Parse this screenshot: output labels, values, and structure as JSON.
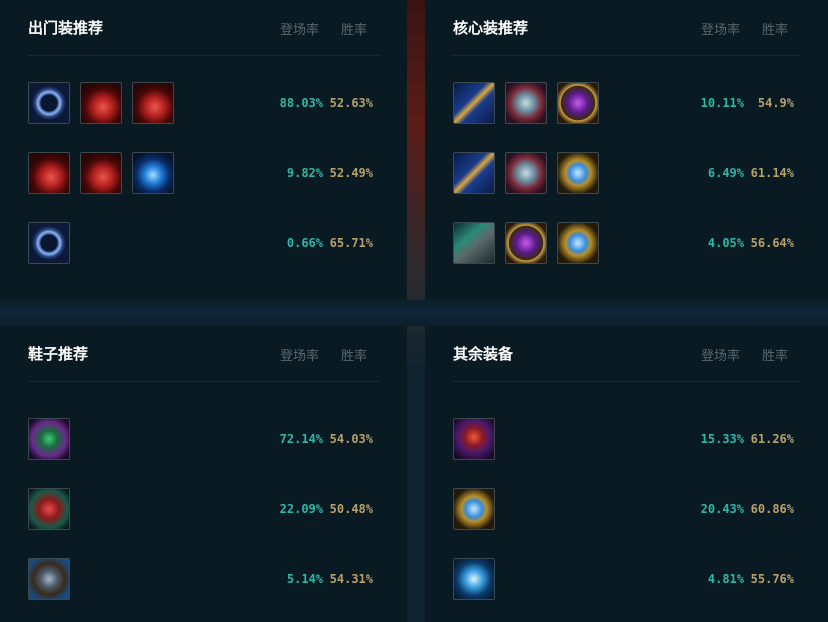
{
  "headers": {
    "pick_rate": "登场率",
    "win_rate": "胜率"
  },
  "panels": [
    {
      "title": "出门装推荐",
      "rows": [
        {
          "items": [
            "ring-icon",
            "health-potion-icon",
            "health-potion-icon"
          ],
          "pick": "88.03%",
          "win": "52.63%"
        },
        {
          "items": [
            "health-potion-icon",
            "health-potion-icon",
            "mana-drop-icon"
          ],
          "pick": "9.82%",
          "win": "52.49%"
        },
        {
          "items": [
            "ring-icon"
          ],
          "pick": "0.66%",
          "win": "65.71%"
        }
      ]
    },
    {
      "title": "核心装推荐",
      "rows": [
        {
          "items": [
            "golden-staff-icon",
            "mask-icon",
            "dark-seal-icon"
          ],
          "pick": "10.11%",
          "win": "54.9%"
        },
        {
          "items": [
            "golden-staff-icon",
            "mask-icon",
            "hourglass-icon"
          ],
          "pick": "6.49%",
          "win": "61.14%"
        },
        {
          "items": [
            "gunblade-icon",
            "dark-seal-icon",
            "hourglass-icon"
          ],
          "pick": "4.05%",
          "win": "56.64%"
        }
      ]
    },
    {
      "title": "鞋子推荐",
      "rows": [
        {
          "items": [
            "sorcerer-boots-icon"
          ],
          "pick": "72.14%",
          "win": "54.03%"
        },
        {
          "items": [
            "mercury-boots-icon"
          ],
          "pick": "22.09%",
          "win": "50.48%"
        },
        {
          "items": [
            "ionian-boots-icon"
          ],
          "pick": "5.14%",
          "win": "54.31%"
        }
      ]
    },
    {
      "title": "其余装备",
      "rows": [
        {
          "items": [
            "wizard-hat-icon"
          ],
          "pick": "15.33%",
          "win": "61.26%"
        },
        {
          "items": [
            "hourglass-icon"
          ],
          "pick": "20.43%",
          "win": "60.86%"
        },
        {
          "items": [
            "void-staff-icon"
          ],
          "pick": "4.81%",
          "win": "55.76%"
        }
      ]
    }
  ]
}
